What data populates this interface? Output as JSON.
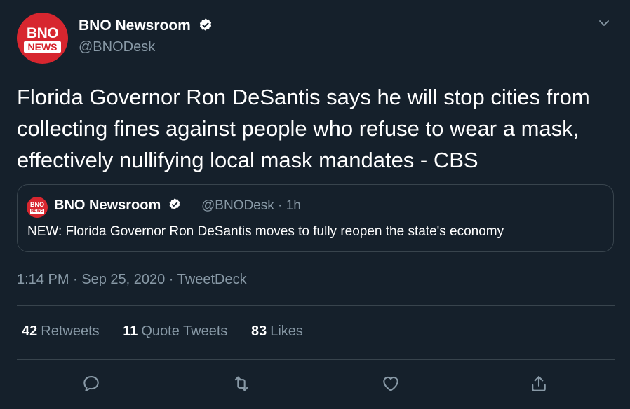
{
  "author": {
    "avatar_text_top": "BNO",
    "avatar_text_bottom": "NEWS",
    "display_name": "BNO Newsroom",
    "handle": "@BNODesk",
    "verified_icon": "verified-badge-icon"
  },
  "tweet": {
    "text": "Florida Governor Ron DeSantis says he will stop cities from collecting fines against people who refuse to wear a mask, effectively nullifying local mask mandates - CBS"
  },
  "quoted_tweet": {
    "display_name": "BNO Newsroom",
    "handle_time": "@BNODesk · 1h",
    "text": "NEW: Florida Governor Ron DeSantis moves to fully reopen the state's economy"
  },
  "meta": {
    "line": "1:14 PM · Sep 25, 2020 · TweetDeck"
  },
  "stats": {
    "retweets_count": "42",
    "retweets_label": "Retweets",
    "quotes_count": "11",
    "quotes_label": "Quote Tweets",
    "likes_count": "83",
    "likes_label": "Likes"
  },
  "colors": {
    "background": "#15202b",
    "muted": "#8899a6",
    "border": "#38444d",
    "brand_red": "#d7262f"
  }
}
